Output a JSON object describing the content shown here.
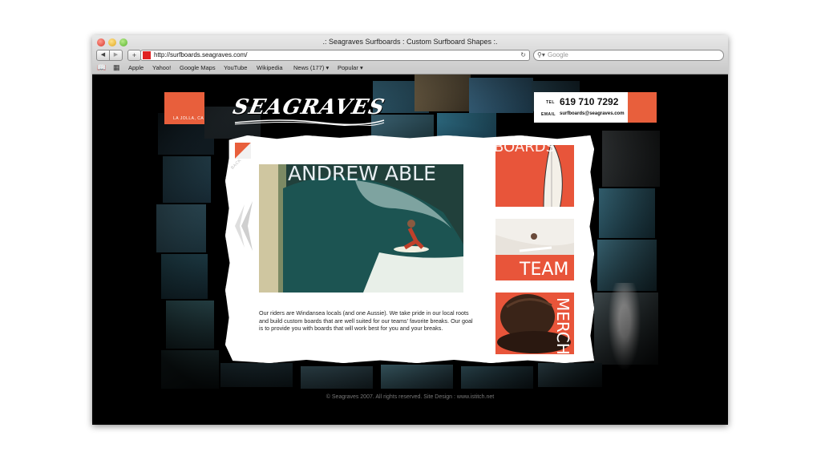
{
  "browser": {
    "title": ".: Seagraves Surfboards : Custom Surfboard Shapes :.",
    "url": "http://surfboards.seagraves.com/",
    "search_placeholder": "Google",
    "bookmarks": [
      "Apple",
      "Yahoo!",
      "Google Maps",
      "YouTube",
      "Wikipedia",
      "News (177)",
      "Popular"
    ]
  },
  "site": {
    "location": "LA JOLLA, CA",
    "logo_text": "SEAGRAVES",
    "contact": {
      "tel_label": "TEL",
      "tel": "619 710 7292",
      "email_label": "EMAIL",
      "email": "surfboards@seagraves.com"
    },
    "back_label": "BACK",
    "rider_name": "ANDREW ABLE",
    "bio": "Our riders are Windansea locals (and one Aussie). We take pride in our local roots and build custom boards that are well suited for our teams' favorite breaks. Our goal is to provide you with boards that will work best for you and your breaks.",
    "nav": {
      "boards": "BOARDS",
      "team": "TEAM",
      "merch": "MERCH"
    },
    "footer": "© Seagraves 2007. All rights reserved. Site Design : www.istitch.net"
  },
  "colors": {
    "accent": "#e85f3c",
    "background": "#000000",
    "paper": "#ffffff"
  }
}
